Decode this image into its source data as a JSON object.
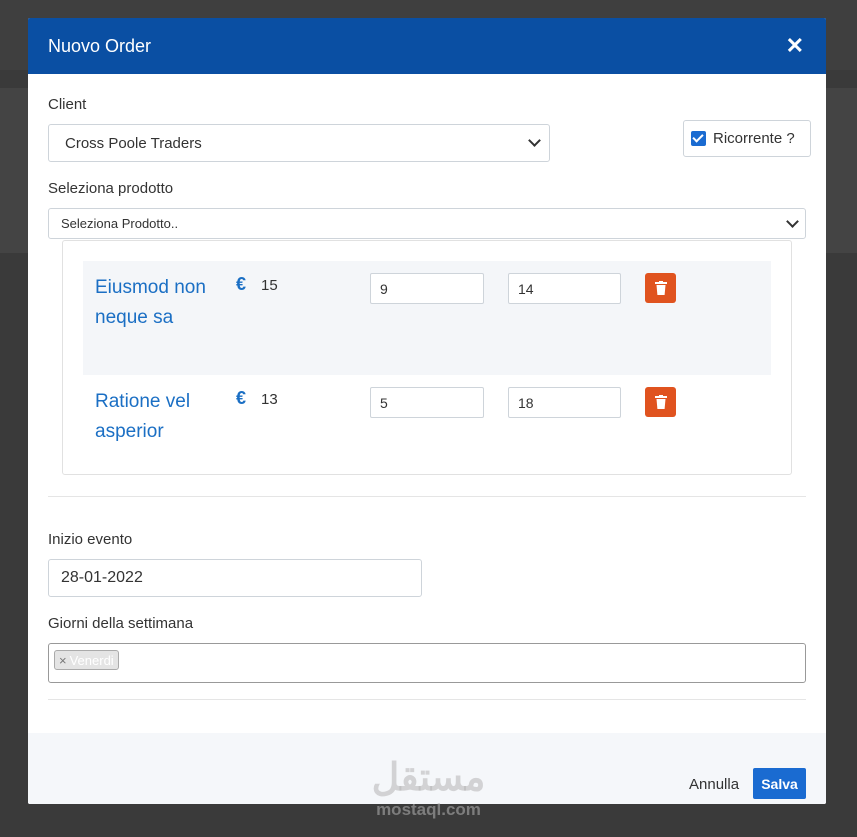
{
  "modal": {
    "title": "Nuovo Order",
    "close_icon": "close-icon"
  },
  "client": {
    "label": "Client",
    "selected": "Cross Poole Traders"
  },
  "recurring": {
    "label": "Ricorrente ?",
    "checked": true
  },
  "product_select": {
    "label": "Seleziona prodotto",
    "placeholder": "Seleziona Prodotto.."
  },
  "products": [
    {
      "name": "Eiusmod non neque sa",
      "currency": "€",
      "price": "15",
      "qty": "9",
      "value": "14"
    },
    {
      "name": "Ratione vel asperior",
      "currency": "€",
      "price": "13",
      "qty": "5",
      "value": "18"
    }
  ],
  "event": {
    "start_label": "Inizio evento",
    "start_value": "28-01-2022",
    "days_label": "Giorni della settimana",
    "days": [
      "Venerdi"
    ]
  },
  "footer": {
    "cancel_label": "Annulla",
    "save_label": "Salva"
  },
  "watermark": {
    "arabic": "مستقل",
    "latin": "mostaql.com"
  },
  "colors": {
    "header": "#0a4fa3",
    "accent": "#1a6bd1",
    "danger": "#e0531f",
    "product_link": "#1b6fc4"
  }
}
